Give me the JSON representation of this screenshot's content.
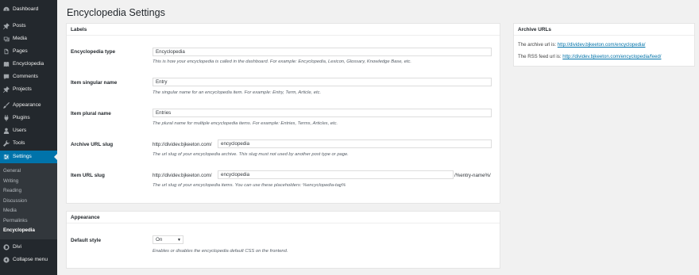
{
  "sidebar": {
    "items": [
      {
        "label": "Dashboard",
        "icon": "dashboard-icon"
      },
      {
        "label": "Posts",
        "icon": "pin-icon"
      },
      {
        "label": "Media",
        "icon": "media-icon"
      },
      {
        "label": "Pages",
        "icon": "page-icon"
      },
      {
        "label": "Encyclopedia",
        "icon": "book-icon"
      },
      {
        "label": "Comments",
        "icon": "comment-icon"
      },
      {
        "label": "Projects",
        "icon": "pin-icon"
      },
      {
        "label": "Appearance",
        "icon": "brush-icon"
      },
      {
        "label": "Plugins",
        "icon": "plug-icon"
      },
      {
        "label": "Users",
        "icon": "user-icon"
      },
      {
        "label": "Tools",
        "icon": "wrench-icon"
      },
      {
        "label": "Settings",
        "icon": "settings-icon"
      },
      {
        "label": "Divi",
        "icon": "divi-icon"
      },
      {
        "label": "Collapse menu",
        "icon": "collapse-icon"
      }
    ],
    "submenu": [
      "General",
      "Writing",
      "Reading",
      "Discussion",
      "Media",
      "Permalinks",
      "Encyclopedia"
    ]
  },
  "page": {
    "title": "Encyclopedia Settings"
  },
  "labels_box": {
    "title": "Labels",
    "type_label": "Encyclopedia type",
    "type_value": "Encyclopedia",
    "type_desc": "This is how your encyclopedia is called in the dashboard. For example: Encyclopedia, Lexicon, Glossary, Knowledge Base, etc.",
    "singular_label": "Item singular name",
    "singular_value": "Entry",
    "singular_desc": "The singular name for an encyclopedia item. For example: Entry, Term, Article, etc.",
    "plural_label": "Item plural name",
    "plural_value": "Entries",
    "plural_desc": "The plural name for multiple encyclopedia items. For example: Entries, Terms, Articles, etc.",
    "archive_label": "Archive URL slug",
    "archive_prefix": "http://dividev.bjkeeton.com/",
    "archive_value": "encyclopedia",
    "archive_desc": "The url slug of your encyclopedia archive. This slug must not used by another post type or page.",
    "item_label": "Item URL slug",
    "item_prefix": "http://dividev.bjkeeton.com/",
    "item_value": "encyclopedia",
    "item_suffix": "/%entry-name%/",
    "item_desc": "The url slug of your encyclopedia items. You can use these placeholders: %encyclopedia-tag%"
  },
  "appearance_box": {
    "title": "Appearance",
    "style_label": "Default style",
    "style_value": "On",
    "style_desc": "Enables or disables the encyclopedia default CSS on the frontend."
  },
  "archive_box": {
    "title": "Archive URLs",
    "archive_text": "The archive url is: ",
    "archive_url": "http://dividev.bjkeeton.com/encyclopedia/",
    "rss_text": "The RSS feed url is: ",
    "rss_url": "http://dividev.bjkeeton.com/encyclopedia/feed/"
  },
  "colors": {
    "sidebar_bg": "#23282d",
    "submenu_bg": "#32373c",
    "accent": "#0073aa",
    "page_bg": "#f1f1f1"
  }
}
